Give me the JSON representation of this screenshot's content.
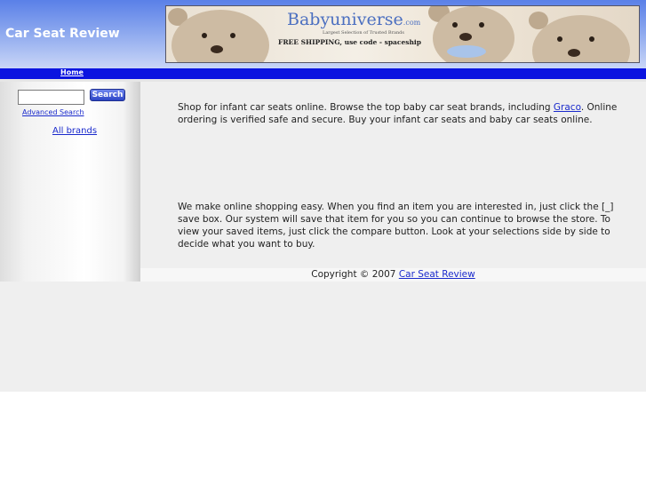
{
  "header": {
    "site_title": "Car Seat Review",
    "banner": {
      "logo_text": "Babyuniverse",
      "logo_suffix": ".com",
      "logo_subtitle": "Largest Selection of Trusted Brands",
      "promo": "FREE SHIPPING, use code - spaceship"
    }
  },
  "nav": {
    "home_label": "Home"
  },
  "sidebar": {
    "search_placeholder": "",
    "search_button": "Search",
    "advanced_search": "Advanced Search",
    "all_brands": "All brands"
  },
  "main": {
    "para1_before": "Shop for infant car seats online.  Browse the top baby car seat brands, including ",
    "para1_link": "Graco",
    "para1_after": ".  Online ordering is verified safe and secure.  Buy your infant car seats and baby car seats online.",
    "para2": "We make online shopping easy.  When you find an item you are interested in, just click the [_] save box.  Our system will save that item for you so you can continue to browse the store.  To view your saved items, just click the compare button.  Look at your selections side by side to decide what you want to buy."
  },
  "footer": {
    "copyright": "Copyright © 2007 ",
    "link": "Car Seat Review"
  },
  "colors": {
    "nav_bar": "#0b14e0",
    "link": "#1a2acc",
    "header_gradient_top": "#5a80e8"
  }
}
